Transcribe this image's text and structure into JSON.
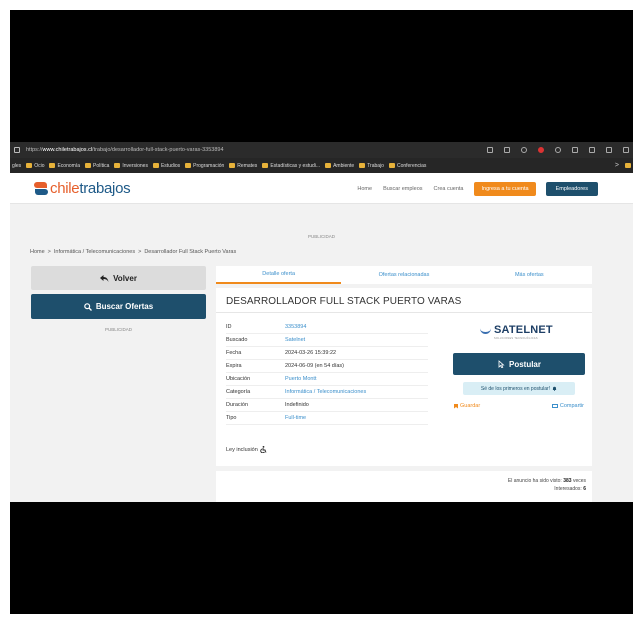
{
  "browser": {
    "url_prefix": "https://",
    "url_host": "www.chiletrabajos.cl",
    "url_path": "/trabajo/desarrollador-full-stack-puerto-varas-3353894",
    "bookmarks": [
      "Ocio",
      "Economía",
      "Política",
      "Inversiones",
      "Estudios",
      "Programación",
      "Remates",
      "Estadísticas y estudi...",
      "Ambiente",
      "Trabajo",
      "Conferencias"
    ],
    "bookmarks_leading": "gles",
    "bookmarks_more": ">"
  },
  "site": {
    "logo_chile": "chile",
    "logo_trabajos": "trabajos",
    "nav": {
      "home": "Home",
      "buscar": "Buscar empleos",
      "crea": "Crea cuenta",
      "login": "Ingresa a tu cuenta",
      "employers": "Empleadores"
    }
  },
  "publicidad": "PUBLICIDAD",
  "breadcrumb": [
    "Home",
    "Informática / Telecomunicaciones",
    "Desarrollador Full Stack Puerto Varas"
  ],
  "breadcrumb_sep": ">",
  "left": {
    "volver": "Volver",
    "buscar": "Buscar Ofertas",
    "publicidad": "PUBLICIDAD"
  },
  "tabs": [
    "Detalle oferta",
    "Ofertas relacionadas",
    "Más ofertas"
  ],
  "job": {
    "title": "DESARROLLADOR FULL STACK PUERTO VARAS",
    "details": [
      {
        "key": "ID",
        "value": "3353894",
        "link": true
      },
      {
        "key": "Buscado",
        "value": "Satelnet",
        "link": true
      },
      {
        "key": "Fecha",
        "value": "2024-03-26 15:39:22",
        "link": false
      },
      {
        "key": "Expira",
        "value": "2024-06-09 (en 54 días)",
        "link": false
      },
      {
        "key": "Ubicación",
        "value": "Puerto Montt",
        "link": true
      },
      {
        "key": "Categoría",
        "value": "Informática / Telecomunicaciones",
        "link": true
      },
      {
        "key": "Duración",
        "value": "Indefinido",
        "link": false
      },
      {
        "key": "Tipo",
        "value": "Full-time",
        "link": true
      }
    ],
    "ley_inclusion": "Ley inclusión"
  },
  "company": {
    "name": "SATELNET",
    "subtitle": "SOLUCIONES TECNOLÓGICAS"
  },
  "actions": {
    "postular": "Postular",
    "primero": "Sé de los primeros en postular!",
    "guardar": "Guardar",
    "compartir": "Compartir"
  },
  "stats": {
    "visto_label": "El anuncio ha sido visto:",
    "visto_count": "383",
    "visto_suffix": "veces",
    "interesados_label": "Interesados:",
    "interesados_count": "6"
  },
  "colors": {
    "brand_orange": "#f08a1c",
    "brand_navy": "#1e4f6c",
    "link_blue": "#3b8fcb"
  }
}
